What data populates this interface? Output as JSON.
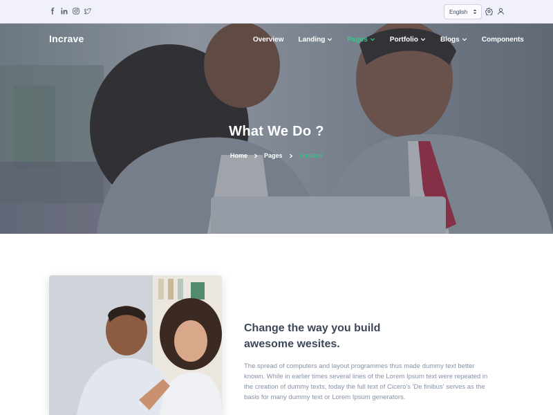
{
  "topbar": {
    "social": [
      "facebook-icon",
      "linkedin-icon",
      "instagram-icon",
      "twitter-icon"
    ],
    "language": "English",
    "icons": [
      "settings-icon",
      "user-icon"
    ]
  },
  "header": {
    "brand": "Incrave",
    "nav": [
      {
        "label": "Overview",
        "dropdown": false,
        "active": false
      },
      {
        "label": "Landing",
        "dropdown": true,
        "active": false
      },
      {
        "label": "Pages",
        "dropdown": true,
        "active": true
      },
      {
        "label": "Portfolio",
        "dropdown": true,
        "active": false
      },
      {
        "label": "Blogs",
        "dropdown": true,
        "active": false
      },
      {
        "label": "Components",
        "dropdown": false,
        "active": false
      }
    ]
  },
  "hero": {
    "title": "What We Do ?",
    "breadcrumb": [
      "Home",
      "Pages",
      "Services"
    ]
  },
  "content": {
    "title_line1": "Change the way you build",
    "title_line2": "awesome wesites.",
    "text": "The spread of computers and layout programmes thus made dummy text better known. While in earlier times several lines of the Lorem Ipsum text were repeated in the creation of dummy texts, today the full text of Cicero's 'De finibus' serves as the basis for many dummy text or Lorem Ipsum generators."
  },
  "colors": {
    "accent": "#2eca8b",
    "heading": "#3c4858",
    "muted": "#8492a6",
    "topbar_bg": "#f1f1fb"
  }
}
